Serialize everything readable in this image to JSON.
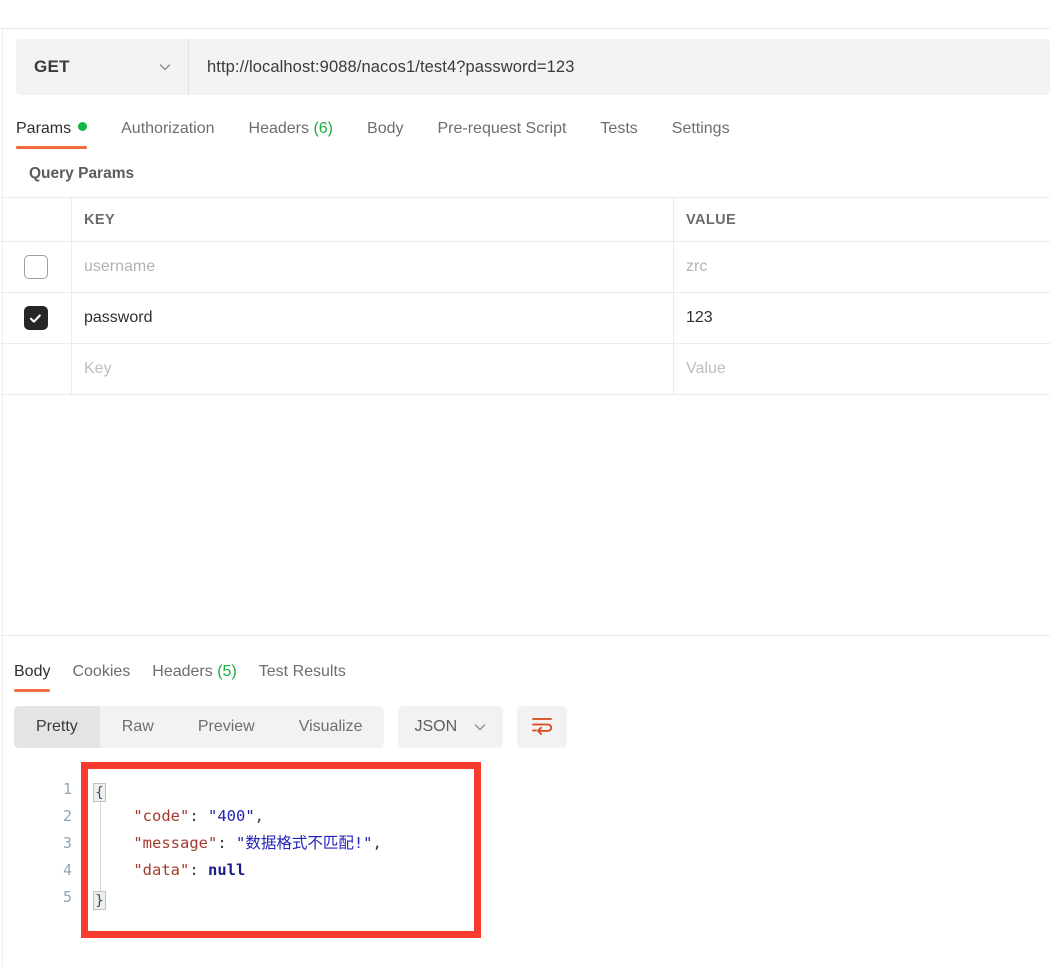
{
  "request": {
    "method": "GET",
    "method_icon": "chevron-down-icon",
    "url": "http://localhost:9088/nacos1/test4?password=123",
    "url_placeholder": "Enter request URL",
    "tabs": [
      {
        "label": "Params",
        "badge_dot": true,
        "active": true
      },
      {
        "label": "Authorization",
        "active": false
      },
      {
        "label": "Headers",
        "count": "(6)",
        "active": false
      },
      {
        "label": "Body",
        "active": false
      },
      {
        "label": "Pre-request Script",
        "active": false
      },
      {
        "label": "Tests",
        "active": false
      },
      {
        "label": "Settings",
        "active": false
      }
    ]
  },
  "query_params": {
    "section_title": "Query Params",
    "columns": {
      "key": "KEY",
      "value": "VALUE"
    },
    "rows": [
      {
        "checked": false,
        "key": "username",
        "value": "zrc",
        "muted": true
      },
      {
        "checked": true,
        "key": "password",
        "value": "123",
        "muted": false
      }
    ],
    "new_row": {
      "key_placeholder": "Key",
      "value_placeholder": "Value"
    }
  },
  "response": {
    "tabs": [
      {
        "label": "Body",
        "active": true
      },
      {
        "label": "Cookies",
        "active": false
      },
      {
        "label": "Headers",
        "count": "(5)",
        "active": false
      },
      {
        "label": "Test Results",
        "active": false
      }
    ],
    "view_modes": [
      {
        "label": "Pretty",
        "active": true
      },
      {
        "label": "Raw",
        "active": false
      },
      {
        "label": "Preview",
        "active": false
      },
      {
        "label": "Visualize",
        "active": false
      }
    ],
    "format": {
      "label": "JSON",
      "icon": "chevron-down-icon"
    },
    "wrap_button_icon": "word-wrap-icon",
    "body": {
      "line_numbers": [
        "1",
        "2",
        "3",
        "4",
        "5"
      ],
      "fold_open": "{",
      "fold_close": "}",
      "fields": [
        {
          "key": "\"code\"",
          "sep": ": ",
          "value": "\"400\"",
          "type": "string",
          "comma": ","
        },
        {
          "key": "\"message\"",
          "sep": ": ",
          "value": "\"数据格式不匹配!\"",
          "type": "string",
          "comma": ","
        },
        {
          "key": "\"data\"",
          "sep": ": ",
          "value": "null",
          "type": "null",
          "comma": ""
        }
      ]
    }
  },
  "annotation": {
    "type": "red-rectangle-highlight",
    "color": "#f93a2f"
  },
  "colors": {
    "accent_orange": "#f26b3a",
    "status_green": "#10b648",
    "checkbox_on": "#262626",
    "json_key": "#a33a2e",
    "json_string": "#2222b8",
    "json_null": "#1a1a8c",
    "gutter_text": "#8fa6b5",
    "panel_gray": "#f2f2f2"
  }
}
